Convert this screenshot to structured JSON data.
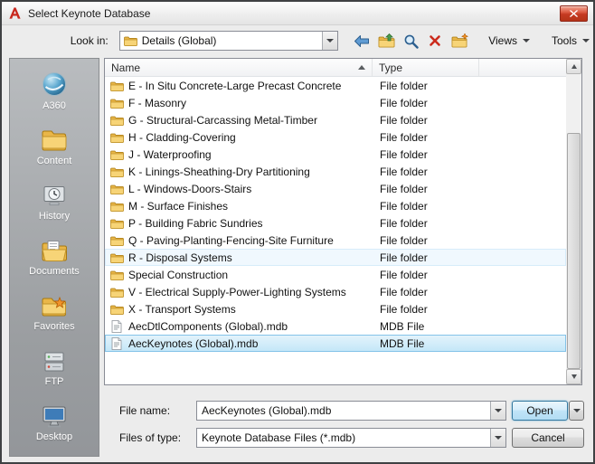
{
  "window": {
    "title": "Select Keynote Database"
  },
  "toolbar": {
    "look_in_label": "Look in:",
    "look_in_value": "Details (Global)",
    "views_label": "Views",
    "tools_label": "Tools",
    "icons": [
      "back-icon",
      "up-one-level-icon",
      "search-icon",
      "delete-icon",
      "new-folder-icon"
    ]
  },
  "sidebar": {
    "items": [
      {
        "label": "A360",
        "icon": "a360-icon"
      },
      {
        "label": "Content",
        "icon": "content-folder-icon"
      },
      {
        "label": "History",
        "icon": "history-icon"
      },
      {
        "label": "Documents",
        "icon": "documents-icon"
      },
      {
        "label": "Favorites",
        "icon": "favorites-icon"
      },
      {
        "label": "FTP",
        "icon": "ftp-icon"
      },
      {
        "label": "Desktop",
        "icon": "desktop-icon"
      }
    ]
  },
  "file_list": {
    "columns": [
      "Name",
      "Type"
    ],
    "sort": {
      "column": "Name",
      "direction": "ascending"
    },
    "rows": [
      {
        "name": "E - In Situ Concrete-Large Precast Concrete",
        "type": "File folder",
        "icon": "folder"
      },
      {
        "name": "F - Masonry",
        "type": "File folder",
        "icon": "folder"
      },
      {
        "name": "G - Structural-Carcassing Metal-Timber",
        "type": "File folder",
        "icon": "folder"
      },
      {
        "name": "H - Cladding-Covering",
        "type": "File folder",
        "icon": "folder"
      },
      {
        "name": "J - Waterproofing",
        "type": "File folder",
        "icon": "folder"
      },
      {
        "name": "K - Linings-Sheathing-Dry Partitioning",
        "type": "File folder",
        "icon": "folder"
      },
      {
        "name": "L - Windows-Doors-Stairs",
        "type": "File folder",
        "icon": "folder"
      },
      {
        "name": "M - Surface Finishes",
        "type": "File folder",
        "icon": "folder"
      },
      {
        "name": "P - Building Fabric Sundries",
        "type": "File folder",
        "icon": "folder"
      },
      {
        "name": "Q - Paving-Planting-Fencing-Site Furniture",
        "type": "File folder",
        "icon": "folder"
      },
      {
        "name": "R - Disposal Systems",
        "type": "File folder",
        "icon": "folder",
        "state": "hovered"
      },
      {
        "name": "Special Construction",
        "type": "File folder",
        "icon": "folder"
      },
      {
        "name": "V - Electrical Supply-Power-Lighting Systems",
        "type": "File folder",
        "icon": "folder"
      },
      {
        "name": "X - Transport Systems",
        "type": "File folder",
        "icon": "folder"
      },
      {
        "name": "AecDtlComponents (Global).mdb",
        "type": "MDB File",
        "icon": "file"
      },
      {
        "name": "AecKeynotes (Global).mdb",
        "type": "MDB File",
        "icon": "file",
        "state": "selected"
      }
    ]
  },
  "footer": {
    "file_name_label": "File name:",
    "file_name_value": "AecKeynotes (Global).mdb",
    "files_of_type_label": "Files of type:",
    "files_of_type_value": "Keynote Database Files (*.mdb)",
    "open_label": "Open",
    "cancel_label": "Cancel"
  },
  "colors": {
    "selection_fill": "#c4e7f8",
    "selection_border": "#84c3e8",
    "hover_fill": "#f0f8fe",
    "sidebar_gray": "#a5a8ab",
    "close_button_red": "#c53a22",
    "folder_yellow": "#f7d477"
  }
}
